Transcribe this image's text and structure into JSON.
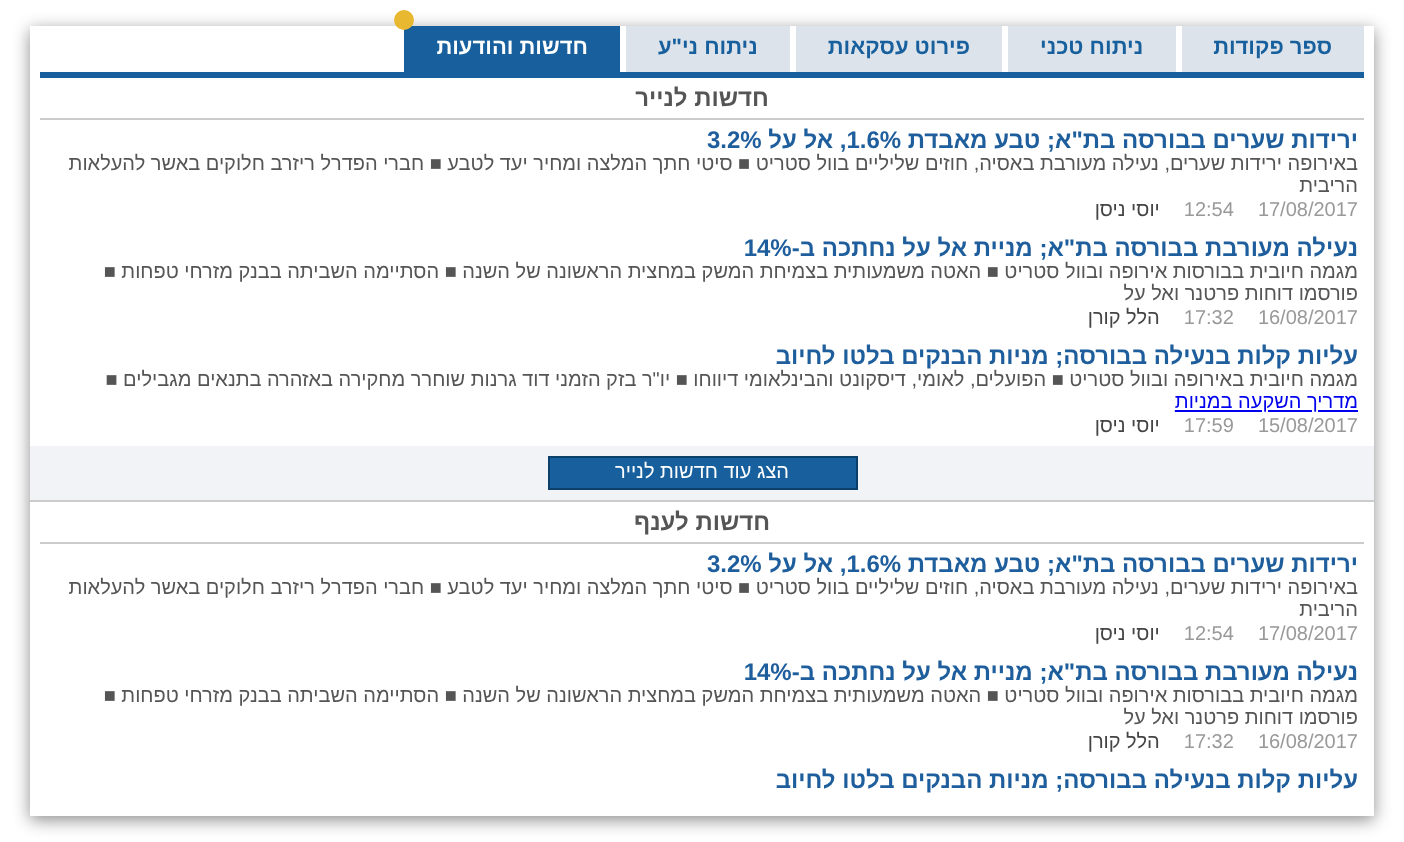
{
  "tabs": [
    {
      "label": "ספר פקודות",
      "selected": false
    },
    {
      "label": "ניתוח טכני",
      "selected": false
    },
    {
      "label": "פירוט עסקאות",
      "selected": false
    },
    {
      "label": "ניתוח ני\"ע",
      "selected": false
    },
    {
      "label": "חדשות והודעות",
      "selected": true,
      "badge": true
    }
  ],
  "sections": [
    {
      "title": "חדשות לנייר",
      "more_button": "הצג עוד חדשות לנייר",
      "items": [
        {
          "headline": "ירידות שערים בבורסה בת\"א; טבע מאבדת 1.6%, אל על 3.2%",
          "summary": "באירופה ירידות שערים, נעילה מעורבת באסיה, חוזים שליליים בוול סטריט ■ סיטי חתך המלצה ומחיר יעד לטבע ■ חברי הפדרל ריזרב חלוקים באשר להעלאות הריבית",
          "date": "17/08/2017",
          "time": "12:54",
          "author": "יוסי ניסן"
        },
        {
          "headline": "נעילה מעורבת בבורסה בת\"א; מניית אל על נחתכה ב-14%",
          "summary": "מגמה חיובית בבורסות אירופה ובוול סטריט ■ האטה משמעותית בצמיחת המשק במחצית הראשונה של השנה ■ הסתיימה השביתה בבנק מזרחי טפחות ■ פורסמו דוחות פרטנר ואל על",
          "date": "16/08/2017",
          "time": "17:32",
          "author": "הלל קורן"
        },
        {
          "headline": "עליות קלות בנעילה בבורסה; מניות הבנקים בלטו לחיוב",
          "summary": "מגמה חיובית באירופה ובוול סטריט ■ הפועלים, לאומי, דיסקונט והבינלאומי דיווחו ■ יו\"ר בזק הזמני דוד גרנות שוחרר מחקירה באזהרה בתנאים מגבילים ■",
          "link": "מדריך השקעה במניות",
          "date": "15/08/2017",
          "time": "17:59",
          "author": "יוסי ניסן"
        }
      ]
    },
    {
      "title": "חדשות לענף",
      "items": [
        {
          "headline": "ירידות שערים בבורסה בת\"א; טבע מאבדת 1.6%, אל על 3.2%",
          "summary": "באירופה ירידות שערים, נעילה מעורבת באסיה, חוזים שליליים בוול סטריט ■ סיטי חתך המלצה ומחיר יעד לטבע ■ חברי הפדרל ריזרב חלוקים באשר להעלאות הריבית",
          "date": "17/08/2017",
          "time": "12:54",
          "author": "יוסי ניסן"
        },
        {
          "headline": "נעילה מעורבת בבורסה בת\"א; מניית אל על נחתכה ב-14%",
          "summary": "מגמה חיובית בבורסות אירופה ובוול סטריט ■ האטה משמעותית בצמיחת המשק במחצית הראשונה של השנה ■ הסתיימה השביתה בבנק מזרחי טפחות ■ פורסמו דוחות פרטנר ואל על",
          "date": "16/08/2017",
          "time": "17:32",
          "author": "הלל קורן"
        },
        {
          "headline": "עליות קלות בנעילה בבורסה; מניות הבנקים בלטו לחיוב"
        }
      ]
    }
  ]
}
